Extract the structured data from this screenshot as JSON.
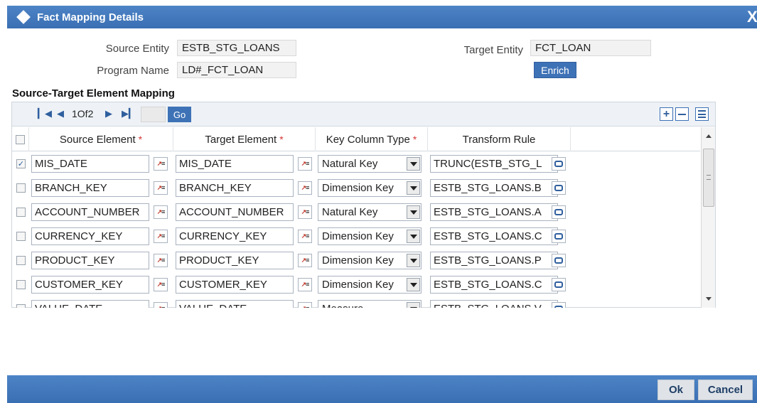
{
  "title": "Fact Mapping Details",
  "close_label": "X",
  "header": {
    "source_entity_label": "Source Entity",
    "source_entity_value": "ESTB_STG_LOANS",
    "program_name_label": "Program Name",
    "program_name_value": "LD#_FCT_LOAN",
    "target_entity_label": "Target Entity",
    "target_entity_value": "FCT_LOAN",
    "enrich_label": "Enrich"
  },
  "section_title": "Source-Target Element Mapping",
  "pager": {
    "page_text": "1Of2",
    "go_label": "Go"
  },
  "columns": {
    "source": "Source Element",
    "target": "Target Element",
    "key_type": "Key Column Type",
    "transform": "Transform Rule",
    "required_mark": "*"
  },
  "rows": [
    {
      "checked": true,
      "source": "MIS_DATE",
      "target": "MIS_DATE",
      "key_type": "Natural Key",
      "transform": "TRUNC(ESTB_STG_L"
    },
    {
      "checked": false,
      "source": "BRANCH_KEY",
      "target": "BRANCH_KEY",
      "key_type": "Dimension Key",
      "transform": "ESTB_STG_LOANS.B"
    },
    {
      "checked": false,
      "source": "ACCOUNT_NUMBER",
      "target": "ACCOUNT_NUMBER",
      "key_type": "Natural Key",
      "transform": "ESTB_STG_LOANS.A"
    },
    {
      "checked": false,
      "source": "CURRENCY_KEY",
      "target": "CURRENCY_KEY",
      "key_type": "Dimension Key",
      "transform": "ESTB_STG_LOANS.C"
    },
    {
      "checked": false,
      "source": "PRODUCT_KEY",
      "target": "PRODUCT_KEY",
      "key_type": "Dimension Key",
      "transform": "ESTB_STG_LOANS.P"
    },
    {
      "checked": false,
      "source": "CUSTOMER_KEY",
      "target": "CUSTOMER_KEY",
      "key_type": "Dimension Key",
      "transform": "ESTB_STG_LOANS.C"
    },
    {
      "checked": false,
      "source": "VALUE_DATE",
      "target": "VALUE_DATE",
      "key_type": "Measure",
      "transform": "ESTB_STG_LOANS.V"
    }
  ],
  "footer": {
    "ok_label": "Ok",
    "cancel_label": "Cancel"
  },
  "colors": {
    "title_bar": "#3e72b6",
    "required": "#d93636"
  }
}
